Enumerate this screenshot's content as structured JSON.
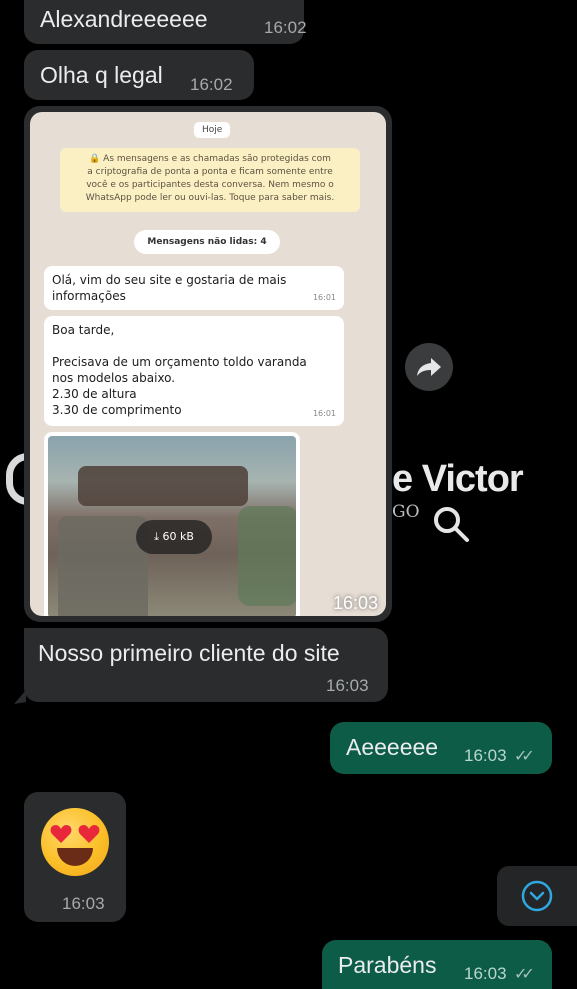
{
  "watermark": {
    "name": "e Victor",
    "suffix": "GO"
  },
  "messages": [
    {
      "id": "m1",
      "text": "Alexandreeeeee",
      "time": "16:02"
    },
    {
      "id": "m2",
      "text": "Olha q legal",
      "time": "16:02"
    },
    {
      "id": "m3",
      "text": "Nosso primeiro cliente do site",
      "time": "16:03"
    },
    {
      "id": "m4",
      "text": "Aeeeeee",
      "time": "16:03"
    },
    {
      "id": "m5",
      "emoji": "heart-eyes-emoji",
      "time": "16:03"
    },
    {
      "id": "m6",
      "text": "Parabéns",
      "time": "16:03"
    }
  ],
  "screenshot": {
    "time": "16:03",
    "day_label": "Hoje",
    "encryption_lines": [
      "🔒 As mensagens e as chamadas são protegidas com",
      "a criptografia de ponta a ponta e ficam somente entre",
      "você e os participantes desta conversa. Nem mesmo o",
      "WhatsApp pode ler ou ouvi-las. Toque para saber mais."
    ],
    "unread_label": "Mensagens não lidas: 4",
    "bubble1": {
      "lines": [
        "Olá, vim do seu site e gostaria de mais",
        "informações"
      ],
      "time": "16:01"
    },
    "bubble2": {
      "lines": [
        "Boa tarde,",
        "",
        "Precisava de um orçamento toldo varanda",
        "nos modelos abaixo.",
        "2.30 de altura",
        "3.30 de comprimento"
      ],
      "time": "16:01"
    },
    "download_size": "60 kB"
  },
  "icons": {
    "forward": "forward-arrow-icon",
    "search": "search-icon",
    "scroll_down": "chevron-down-icon",
    "read_receipt": "double-check-icon"
  },
  "colors": {
    "incoming": "#2b2c2e",
    "outgoing": "#0d5c48",
    "accent": "#2fa7e0"
  }
}
